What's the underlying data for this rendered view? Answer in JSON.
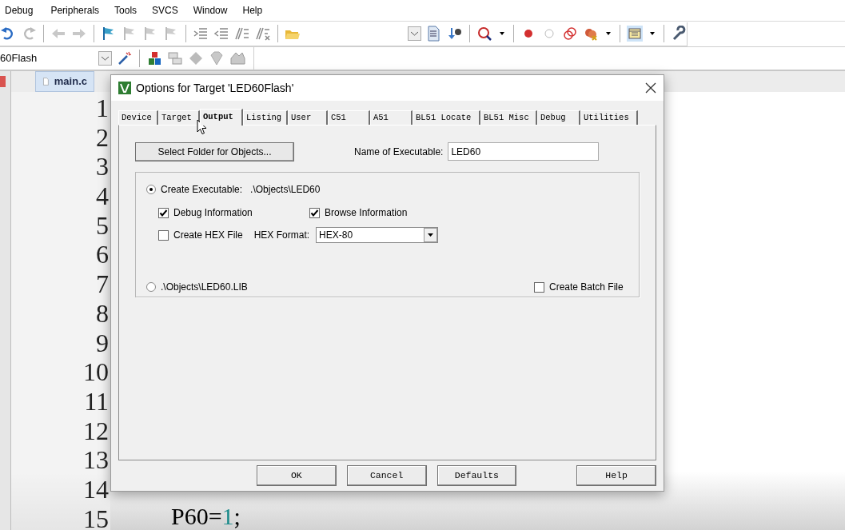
{
  "menu_bar": [
    "Debug",
    "Peripherals",
    "Tools",
    "SVCS",
    "Window",
    "Help"
  ],
  "target_select": {
    "value": "60Flash"
  },
  "editor_tab": {
    "label": "main.c"
  },
  "line_numbers": [
    "1",
    "2",
    "3",
    "4",
    "5",
    "6",
    "7",
    "8",
    "9",
    "10",
    "11",
    "12",
    "13",
    "14",
    "15"
  ],
  "code_line": [
    {
      "text": "P60=",
      "kind": "plain"
    },
    {
      "text": "1",
      "kind": "number"
    },
    {
      "text": ";",
      "kind": "plain"
    }
  ],
  "dialog": {
    "title": "Options for Target 'LED60Flash'",
    "tabs": [
      {
        "label": "Device",
        "selected": false
      },
      {
        "label": "Target",
        "selected": false
      },
      {
        "label": "Output",
        "selected": true
      },
      {
        "label": "Listing",
        "selected": false
      },
      {
        "label": "User",
        "selected": false
      },
      {
        "label": "C51",
        "selected": false
      },
      {
        "label": "A51",
        "selected": false
      },
      {
        "label": "BL51 Locate",
        "selected": false
      },
      {
        "label": "BL51 Misc",
        "selected": false
      },
      {
        "label": "Debug",
        "selected": false
      },
      {
        "label": "Utilities",
        "selected": false
      }
    ],
    "select_folder_button": "Select Folder for Objects...",
    "name_label": "Name of Executable:",
    "name_value": "LED60",
    "create_exe": {
      "label": "Create Executable:",
      "path": ".\\Objects\\LED60",
      "selected": true
    },
    "debug_info": {
      "label": "Debug Information",
      "checked": true
    },
    "browse_info": {
      "label": "Browse Information",
      "checked": true
    },
    "create_hex": {
      "label": "Create HEX File",
      "checked": false
    },
    "hex_format_label": "HEX Format:",
    "hex_format_value": "HEX-80",
    "lib_option": {
      "label": ".\\Objects\\LED60.LIB",
      "selected": false
    },
    "batch_file": {
      "label": "Create Batch File",
      "checked": false
    },
    "buttons": [
      "OK",
      "Cancel",
      "Defaults",
      "Help"
    ]
  }
}
